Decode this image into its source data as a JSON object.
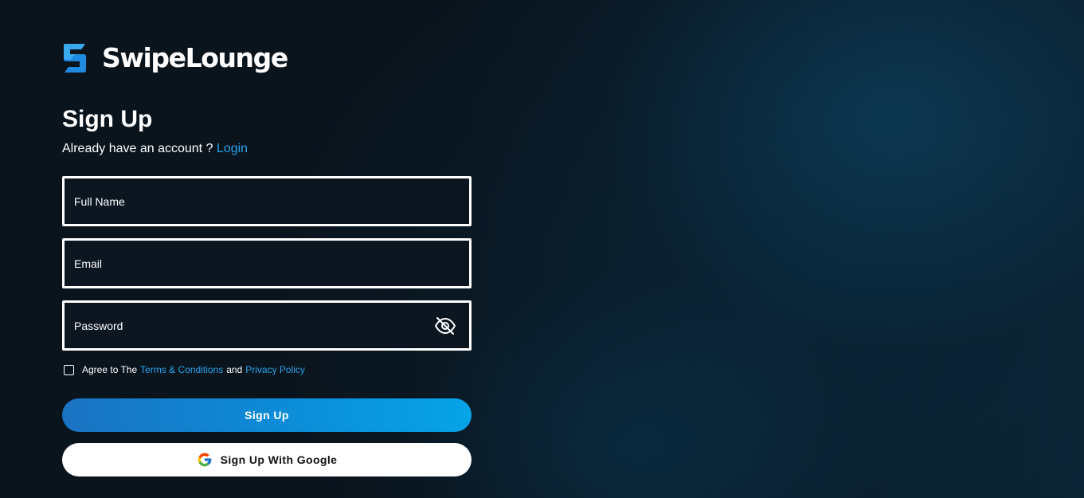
{
  "brand": {
    "name": "SwipeLounge",
    "logo_icon": "swipelounge-s-logo",
    "accent": "#1f8fe0"
  },
  "form": {
    "title": "Sign Up",
    "subtitle_text": "Already have an account ?",
    "login_link": "Login",
    "fields": {
      "full_name_placeholder": "Full Name",
      "email_placeholder": "Email",
      "password_placeholder": "Password"
    },
    "password_toggle_icon": "eye-off-icon",
    "agree": {
      "prefix": "Agree to The",
      "terms_link": "Terms & Conditions",
      "joiner": "and",
      "privacy_link": "Privacy Policy",
      "checked": false
    },
    "signup_button": "Sign Up",
    "google_button": "Sign Up With Google",
    "google_icon": "google-g-icon"
  },
  "colors": {
    "background": "#0b1621",
    "link": "#26a3ec",
    "button_gradient_start": "#1a73c2",
    "button_gradient_end": "#06a4e8"
  }
}
